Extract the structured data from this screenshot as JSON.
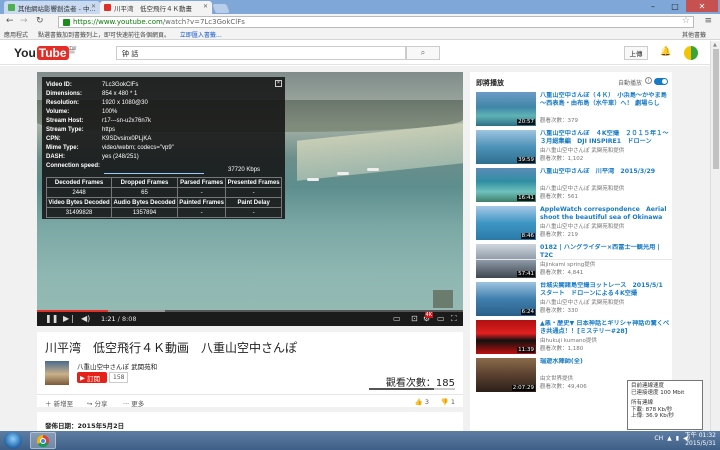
{
  "browser": {
    "tabs": [
      {
        "label": "其他網站影響創造者 - 中...",
        "active": false
      },
      {
        "label": "川平湾　低空飛行４Ｋ動畫",
        "active": true
      }
    ],
    "url_host": "https://www.youtube.com",
    "url_path": "/watch?v=7Lc3GokClFs",
    "bookmarks": {
      "apps": "應用程式",
      "hint": "點選書籤加到書籤列上，即可快速前往各個網頁。",
      "import": "立即匯入書籤…",
      "other": "其他書籤"
    }
  },
  "youtube": {
    "logo_you": "You",
    "logo_tube": "Tube",
    "logo_region": "TW",
    "search_value": "钟  話",
    "upload_label": "上傳"
  },
  "player": {
    "stats_rows": [
      {
        "k": "Video ID:",
        "v": "7Lc3GokClFs"
      },
      {
        "k": "Dimensions:",
        "v": "854 x 480 * 1"
      },
      {
        "k": "Resolution:",
        "v": "1920 x 1080@30"
      },
      {
        "k": "Volume:",
        "v": "100%"
      },
      {
        "k": "Stream Host:",
        "v": "r17---sn-u2x76n7k"
      },
      {
        "k": "Stream Type:",
        "v": "https"
      },
      {
        "k": "CPN:",
        "v": "K9SDvsinx0PLjKA"
      },
      {
        "k": "Mime Type:",
        "v": "video/webm; codecs=\"vp9\""
      },
      {
        "k": "DASH:",
        "v": "yes (248/251)"
      }
    ],
    "stats_close": "[X]",
    "speed_label": "Connection speed:",
    "speed_value": "37720 Kbps",
    "frames_headers": [
      "Decoded Frames",
      "Dropped Frames",
      "Parsed Frames",
      "Presented Frames"
    ],
    "frames_values": [
      "2448",
      "65",
      "-",
      "-"
    ],
    "bytes_headers": [
      "Video Bytes Decoded",
      "Audio Bytes Decoded",
      "Painted Frames",
      "Paint Delay"
    ],
    "bytes_values": [
      "31499828",
      "1357894",
      "-",
      "-"
    ],
    "time_current": "1:21",
    "time_total": "8:08",
    "progress_played": 0.166,
    "progress_loaded": 0.3
  },
  "video": {
    "title": "川平湾　低空飛行４Ｋ動画　八重山空中さんぽ",
    "channel": "八重山空中さんぽ 武関苑和",
    "subscribe_label": "訂閱",
    "subscriber_count": "158",
    "views": "觀看次數：185",
    "like_ratio": 0.75,
    "add_label": "新增至",
    "share_label": "分享",
    "more_label": "更多",
    "likes": "3",
    "dislikes": "1",
    "published": "發佈日期：2015年5月2日"
  },
  "sidebar": {
    "up_next": "即將播放",
    "autoplay": "自動播放",
    "items": [
      {
        "title": "八重山空中さんぽ（４Ｋ）　小浜島～かやま島～西表島・由布島（水牛車）へ！ 劇場らし",
        "channel": "",
        "views": "觀看次數：379",
        "duration": "20:57",
        "thumb": "linear-gradient(180deg,#6b9bc7 0%,#3f86a6 45%,#5fb3b5 70%,#2e6f85 100%)"
      },
      {
        "title": "八重山空中さんぽ　４K空撮　２０１５年１～３月総集編　DJI INSPIRE1　ドローン",
        "channel": "由八重山空中さんぽ 武関苑和提供",
        "views": "觀看次數：1,102",
        "duration": "39:59",
        "thumb": "linear-gradient(180deg,#9ec4e0 0%,#4d92b8 50%,#2d6f8f 100%)"
      },
      {
        "title": "八重山空中さんぽ　川平湾　2015/3/29",
        "channel": "由八重山空中さんぽ 武関苑和提供",
        "views": "觀看次數：561",
        "duration": "16:41",
        "thumb": "linear-gradient(180deg,#5c8bb7 0%,#2f8ea3 40%,#6fc1bc 70%,#3e7f6a 100%)"
      },
      {
        "title": "AppleWatch correspondence　Aerial shoot the beautiful sea of Okinawa",
        "channel": "由八重山空中さんぽ 武関苑和提供",
        "views": "觀看次數：219",
        "duration": "8:46",
        "thumb": "linear-gradient(180deg,#a7c8e6 0%,#3e96c4 50%,#2a7aa8 100%)"
      },
      {
        "title": "0182 | ハングライダー×西富士一観光用 | T2C",
        "channel": "由jinkami spring提供",
        "views": "觀看次數：4,841",
        "duration": "57:41",
        "thumb": "linear-gradient(180deg,#cfd6de 0%,#8a96a3 50%,#3e4650 100%)"
      },
      {
        "title": "台城尖閣諸島空撮ヨットレース　2015/5/1 スタート　ドローンによる４K空撮",
        "channel": "由八重山空中さんぽ 武関苑和提供",
        "views": "觀看次數：330",
        "duration": "6:24",
        "thumb": "linear-gradient(180deg,#9fc3df 0%,#3f7fae 50%,#2c5f8a 100%)"
      },
      {
        "title": "▲悪・歴史▼ 日本神話とギリシャ神話の驚くべき共通点！！[ミステリー#28]",
        "channel": "由hukuji kumano提供",
        "views": "觀看次數：1,180",
        "duration": "11:39",
        "thumb": "linear-gradient(180deg,#b01010 0%,#e02020 40%,#111 60%,#c01010 100%)"
      },
      {
        "title": "瑞遊水陣師(全)",
        "channel": "由文世界提供",
        "views": "觀看次數：49,406",
        "duration": "2:07:29",
        "thumb": "linear-gradient(180deg,#8a6b4a 0%,#5a4030 50%,#2a2018 100%)"
      }
    ]
  },
  "network_tooltip": {
    "lines": [
      "目前連線速度",
      "已連接速度 100 Mbit",
      "",
      "所有連線",
      "下載: 878 Kb/秒",
      "上傳: 36.9 Kb/秒"
    ]
  },
  "taskbar": {
    "tray_text": "CH",
    "time": "下午 01:32",
    "date": "2015/5/31"
  }
}
